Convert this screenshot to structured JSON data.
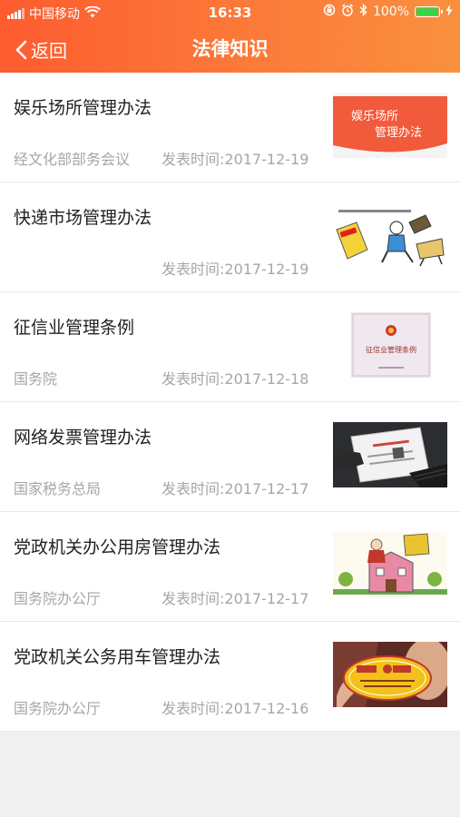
{
  "status_bar": {
    "carrier": "中国移动",
    "time": "16:33",
    "battery": "100%",
    "battery_level": 1.0,
    "icons": [
      "signal-icon",
      "wifi-icon",
      "lock-rotation-icon",
      "alarm-icon",
      "bluetooth-icon",
      "battery-icon",
      "charging-icon"
    ]
  },
  "nav": {
    "back_label": "返回",
    "title": "法律知识"
  },
  "thumbnails": {
    "t0": {
      "line1": "娱乐场所",
      "line2": "管理办法"
    },
    "t2": {
      "caption": "征信业管理条例"
    }
  },
  "items": [
    {
      "title": "娱乐场所管理办法",
      "source": "经文化部部务会议",
      "date": "发表时间:2017-12-19"
    },
    {
      "title": "快递市场管理办法",
      "source": "",
      "date": "发表时间:2017-12-19"
    },
    {
      "title": "征信业管理条例",
      "source": "国务院",
      "date": "发表时间:2017-12-18"
    },
    {
      "title": "网络发票管理办法",
      "source": "国家税务总局",
      "date": "发表时间:2017-12-17"
    },
    {
      "title": "党政机关办公用房管理办法",
      "source": "国务院办公厅",
      "date": "发表时间:2017-12-17"
    },
    {
      "title": "党政机关公务用车管理办法",
      "source": "国务院办公厅",
      "date": "发表时间:2017-12-16"
    }
  ],
  "colors": {
    "header_start": "#fd5c2f",
    "header_end": "#f9903e",
    "title_text": "#222222",
    "meta_text": "#a6a6a6",
    "background": "#f0f0f0"
  }
}
